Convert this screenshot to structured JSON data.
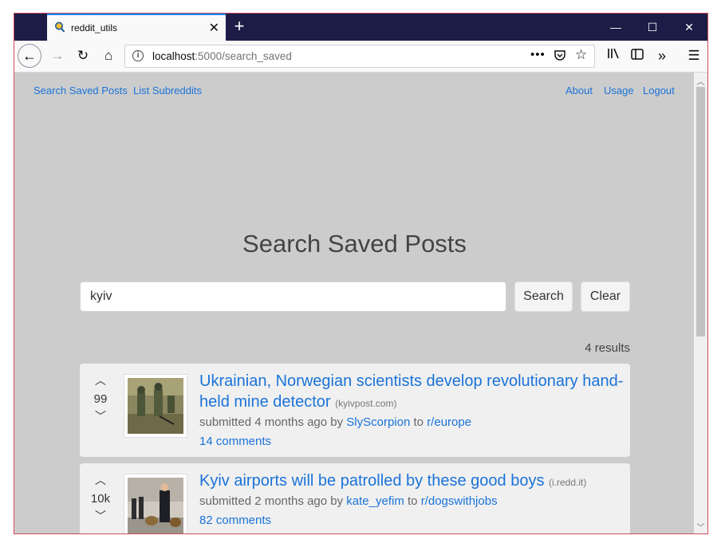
{
  "browser": {
    "tab_title": "reddit_utils",
    "url_host": "localhost",
    "url_path": ":5000/search_saved"
  },
  "nav": {
    "left": [
      "Search Saved Posts",
      "List Subreddits"
    ],
    "right": [
      "About",
      "Usage",
      "Logout"
    ]
  },
  "heading": "Search Saved Posts",
  "search": {
    "value": "kyiv",
    "search_label": "Search",
    "clear_label": "Clear"
  },
  "results_count": "4 results",
  "posts": [
    {
      "score": "99",
      "title_line1": "Ukrainian, Norwegian scientists develop revolutionary hand-",
      "title_line2": "held mine detector",
      "domain": "(kyivpost.com)",
      "submitted": "submitted 4 months ago by",
      "author": "SlyScorpion",
      "to": "to",
      "subreddit": "r/europe",
      "comments": "14 comments"
    },
    {
      "score": "10k",
      "title_line1": "Kyiv airports will be patrolled by these good boys",
      "domain": "(i.redd.it)",
      "submitted": "submitted 2 months ago by",
      "author": "kate_yefim",
      "to": "to",
      "subreddit": "r/dogswithjobs",
      "comments": "82 comments"
    }
  ]
}
